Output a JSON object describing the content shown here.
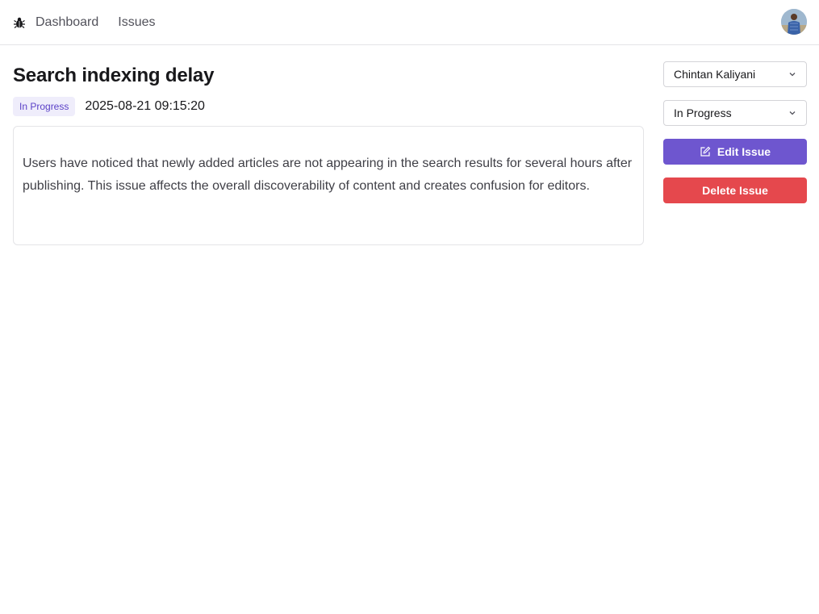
{
  "nav": {
    "logo_icon": "bug-icon",
    "links": [
      "Dashboard",
      "Issues"
    ],
    "avatar_icon": "user-avatar"
  },
  "issue": {
    "title": "Search indexing delay",
    "status_badge": "In Progress",
    "created_at": "2025-08-21 09:15:20",
    "description": "Users have noticed that newly added articles are not appearing in the search results for several hours after publishing. This issue affects the overall discoverability of content and creates confusion for editors."
  },
  "sidebar": {
    "assignee_value": "Chintan Kaliyani",
    "status_value": "In Progress",
    "edit_label": "Edit Issue",
    "delete_label": "Delete Issue",
    "edit_icon": "edit-icon",
    "dropdown_icon": "chevron-down-icon"
  },
  "colors": {
    "accent": "#6e56cf",
    "danger": "#e5484d",
    "badge_bg": "#efedfb",
    "badge_text": "#5b41c7"
  }
}
